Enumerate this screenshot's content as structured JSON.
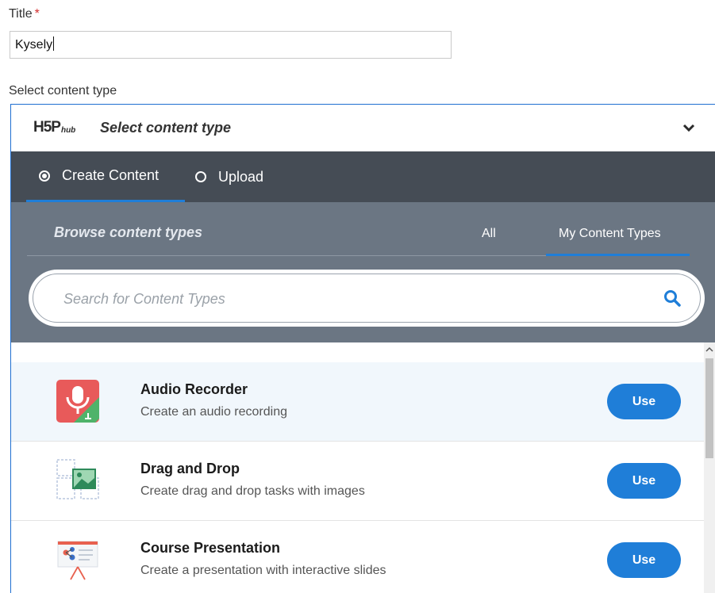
{
  "form": {
    "title_label": "Title",
    "required_mark": "*",
    "title_value": "Kysely",
    "select_label": "Select content type"
  },
  "hub": {
    "logo_main": "H5P",
    "logo_sub": "hub",
    "header_title": "Select content type",
    "tabs": [
      {
        "label": "Create Content",
        "selected": true
      },
      {
        "label": "Upload",
        "selected": false
      }
    ],
    "browse_title": "Browse content types",
    "filters": {
      "all": "All",
      "my": "My Content Types",
      "active": "My Content Types"
    },
    "search": {
      "placeholder": "Search for Content Types"
    },
    "items": [
      {
        "title": "Audio Recorder",
        "description": "Create an audio recording",
        "action": "Use",
        "icon": "microphone-icon"
      },
      {
        "title": "Drag and Drop",
        "description": "Create drag and drop tasks with images",
        "action": "Use",
        "icon": "image-drag-icon"
      },
      {
        "title": "Course Presentation",
        "description": "Create a presentation with interactive slides",
        "action": "Use",
        "icon": "presentation-board-icon"
      }
    ]
  },
  "colors": {
    "accent": "#1f7ed8",
    "tabs_bg": "#454c55",
    "browse_bg": "#6b7683",
    "selected_row": "#f1f7fc",
    "required": "#d32f2f"
  }
}
